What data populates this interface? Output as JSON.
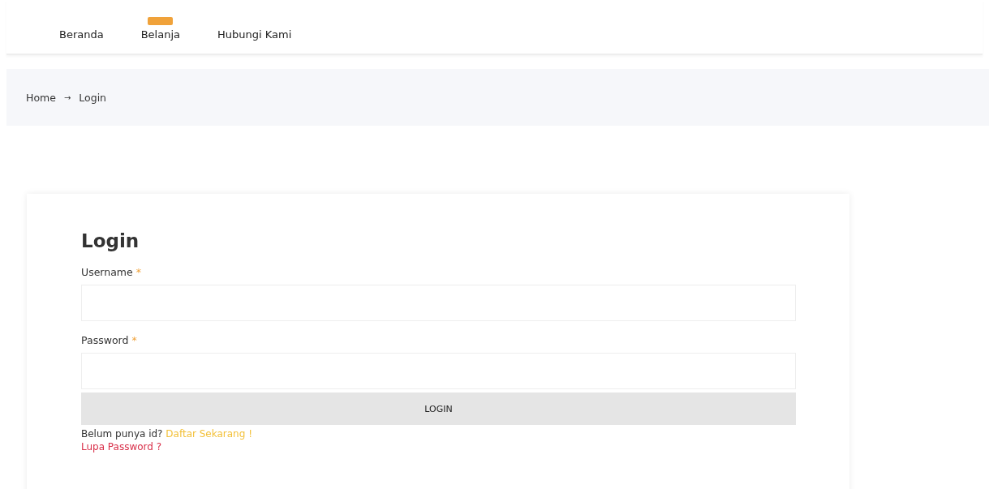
{
  "nav": {
    "items": [
      {
        "label": "Beranda",
        "badge": false
      },
      {
        "label": "Belanja",
        "badge": true
      },
      {
        "label": "Hubungi Kami",
        "badge": false
      }
    ]
  },
  "breadcrumb": {
    "items": [
      "Home",
      "Login"
    ],
    "separator": "→"
  },
  "login": {
    "title": "Login",
    "fields": [
      {
        "label": "Username",
        "required": "*"
      },
      {
        "label": "Password",
        "required": "*"
      }
    ],
    "button": "LOGIN",
    "register_prompt": "Belum punya id?",
    "register_link": "Daftar Sekarang !",
    "forgot_link": "Lupa Password ?"
  }
}
